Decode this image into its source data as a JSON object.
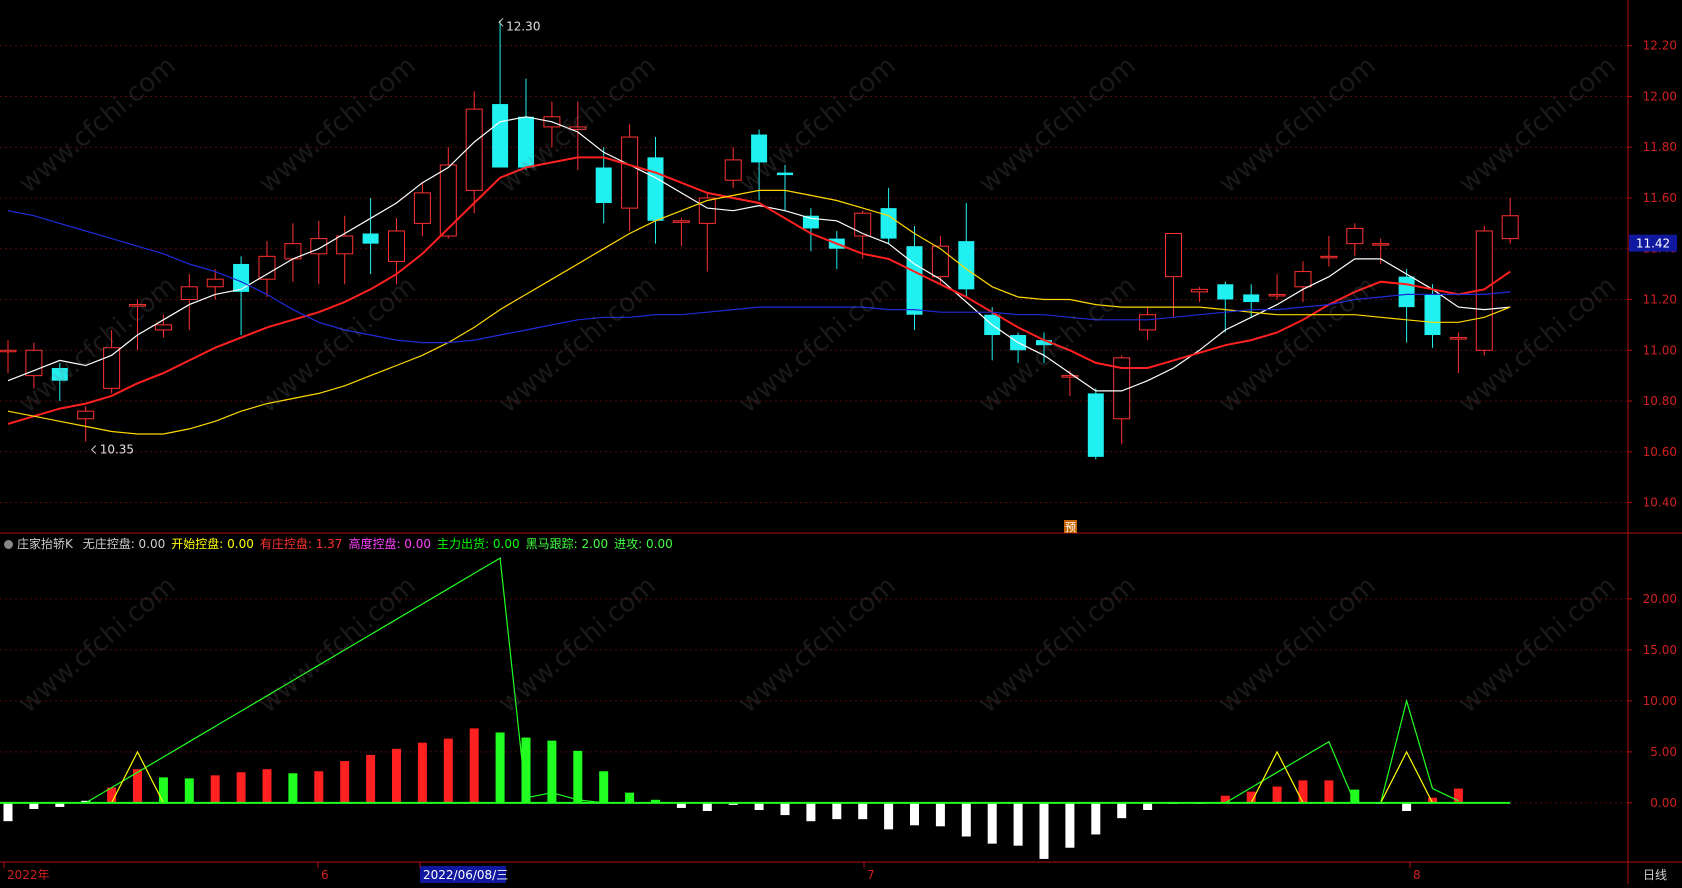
{
  "chart_data": [
    {
      "type": "candlestick",
      "title": "",
      "yaxis": {
        "ticks": [
          "12.20",
          "12.00",
          "11.80",
          "11.60",
          "11.40",
          "11.20",
          "11.00",
          "10.80",
          "10.60",
          "10.40"
        ],
        "range": [
          10.28,
          12.38
        ]
      },
      "last_price_label": "11.42",
      "high_annotation": "12.30",
      "low_annotation": "10.35",
      "pre_marker": "预",
      "candles": [
        {
          "o": 11.0,
          "c": 11.0,
          "h": 11.04,
          "l": 10.91
        },
        {
          "o": 10.9,
          "c": 11.0,
          "h": 11.03,
          "l": 10.85
        },
        {
          "o": 10.93,
          "c": 10.88,
          "h": 10.95,
          "l": 10.8
        },
        {
          "o": 10.73,
          "c": 10.76,
          "h": 10.78,
          "l": 10.64
        },
        {
          "o": 10.85,
          "c": 11.01,
          "h": 11.08,
          "l": 10.83
        },
        {
          "o": 11.18,
          "c": 11.18,
          "h": 11.2,
          "l": 11.0
        },
        {
          "o": 11.08,
          "c": 11.1,
          "h": 11.14,
          "l": 11.05
        },
        {
          "o": 11.2,
          "c": 11.25,
          "h": 11.3,
          "l": 11.08
        },
        {
          "o": 11.25,
          "c": 11.28,
          "h": 11.32,
          "l": 11.2
        },
        {
          "o": 11.34,
          "c": 11.23,
          "h": 11.37,
          "l": 11.06
        },
        {
          "o": 11.28,
          "c": 11.37,
          "h": 11.43,
          "l": 11.21
        },
        {
          "o": 11.36,
          "c": 11.42,
          "h": 11.5,
          "l": 11.27
        },
        {
          "o": 11.38,
          "c": 11.44,
          "h": 11.51,
          "l": 11.26
        },
        {
          "o": 11.38,
          "c": 11.45,
          "h": 11.53,
          "l": 11.26
        },
        {
          "o": 11.46,
          "c": 11.42,
          "h": 11.6,
          "l": 11.3
        },
        {
          "o": 11.35,
          "c": 11.47,
          "h": 11.52,
          "l": 11.26
        },
        {
          "o": 11.5,
          "c": 11.62,
          "h": 11.66,
          "l": 11.45
        },
        {
          "o": 11.45,
          "c": 11.73,
          "h": 11.8,
          "l": 11.44
        },
        {
          "o": 11.63,
          "c": 11.95,
          "h": 12.02,
          "l": 11.54
        },
        {
          "o": 11.97,
          "c": 11.72,
          "h": 12.3,
          "l": 11.72
        },
        {
          "o": 11.92,
          "c": 11.72,
          "h": 12.07,
          "l": 11.71
        },
        {
          "o": 11.88,
          "c": 11.92,
          "h": 11.98,
          "l": 11.8
        },
        {
          "o": 11.87,
          "c": 11.88,
          "h": 11.98,
          "l": 11.71
        },
        {
          "o": 11.72,
          "c": 11.58,
          "h": 11.8,
          "l": 11.5
        },
        {
          "o": 11.56,
          "c": 11.84,
          "h": 11.89,
          "l": 11.47
        },
        {
          "o": 11.76,
          "c": 11.51,
          "h": 11.84,
          "l": 11.42
        },
        {
          "o": 11.51,
          "c": 11.51,
          "h": 11.52,
          "l": 11.41
        },
        {
          "o": 11.5,
          "c": 11.6,
          "h": 11.62,
          "l": 11.31
        },
        {
          "o": 11.67,
          "c": 11.75,
          "h": 11.8,
          "l": 11.64
        },
        {
          "o": 11.85,
          "c": 11.74,
          "h": 11.87,
          "l": 11.59
        },
        {
          "o": 11.7,
          "c": 11.69,
          "h": 11.73,
          "l": 11.55
        },
        {
          "o": 11.53,
          "c": 11.48,
          "h": 11.56,
          "l": 11.39
        },
        {
          "o": 11.44,
          "c": 11.4,
          "h": 11.47,
          "l": 11.32
        },
        {
          "o": 11.45,
          "c": 11.54,
          "h": 11.55,
          "l": 11.36
        },
        {
          "o": 11.56,
          "c": 11.44,
          "h": 11.64,
          "l": 11.42
        },
        {
          "o": 11.41,
          "c": 11.14,
          "h": 11.49,
          "l": 11.08
        },
        {
          "o": 11.29,
          "c": 11.41,
          "h": 11.45,
          "l": 11.26
        },
        {
          "o": 11.43,
          "c": 11.24,
          "h": 11.58,
          "l": 11.21
        },
        {
          "o": 11.14,
          "c": 11.06,
          "h": 11.17,
          "l": 10.96
        },
        {
          "o": 11.06,
          "c": 11.0,
          "h": 11.07,
          "l": 10.95
        },
        {
          "o": 11.04,
          "c": 11.02,
          "h": 11.07,
          "l": 10.95
        },
        {
          "o": 10.9,
          "c": 10.9,
          "h": 10.92,
          "l": 10.82
        },
        {
          "o": 10.83,
          "c": 10.58,
          "h": 10.85,
          "l": 10.57
        },
        {
          "o": 10.73,
          "c": 10.97,
          "h": 10.98,
          "l": 10.63
        },
        {
          "o": 11.08,
          "c": 11.14,
          "h": 11.17,
          "l": 11.04
        },
        {
          "o": 11.29,
          "c": 11.46,
          "h": 11.46,
          "l": 11.13
        },
        {
          "o": 11.23,
          "c": 11.24,
          "h": 11.25,
          "l": 11.19
        },
        {
          "o": 11.26,
          "c": 11.2,
          "h": 11.27,
          "l": 11.07
        },
        {
          "o": 11.22,
          "c": 11.19,
          "h": 11.26,
          "l": 11.13
        },
        {
          "o": 11.22,
          "c": 11.22,
          "h": 11.3,
          "l": 11.2
        },
        {
          "o": 11.25,
          "c": 11.31,
          "h": 11.35,
          "l": 11.19
        },
        {
          "o": 11.37,
          "c": 11.37,
          "h": 11.45,
          "l": 11.33
        },
        {
          "o": 11.42,
          "c": 11.48,
          "h": 11.5,
          "l": 11.37
        },
        {
          "o": 11.42,
          "c": 11.42,
          "h": 11.44,
          "l": 11.34
        },
        {
          "o": 11.29,
          "c": 11.17,
          "h": 11.32,
          "l": 11.03
        },
        {
          "o": 11.22,
          "c": 11.06,
          "h": 11.26,
          "l": 11.01
        },
        {
          "o": 11.05,
          "c": 11.05,
          "h": 11.07,
          "l": 10.91
        },
        {
          "o": 11.0,
          "c": 11.47,
          "h": 11.49,
          "l": 10.98
        },
        {
          "o": 11.44,
          "c": 11.53,
          "h": 11.6,
          "l": 11.42
        }
      ],
      "ma_lines": [
        {
          "color": "#ffffff",
          "values": [
            10.88,
            10.92,
            10.96,
            10.94,
            10.98,
            11.06,
            11.12,
            11.18,
            11.22,
            11.24,
            11.3,
            11.36,
            11.4,
            11.46,
            11.52,
            11.58,
            11.66,
            11.72,
            11.82,
            11.9,
            11.92,
            11.9,
            11.86,
            11.78,
            11.73,
            11.68,
            11.62,
            11.56,
            11.55,
            11.57,
            11.55,
            11.52,
            11.51,
            11.46,
            11.42,
            11.34,
            11.28,
            11.19,
            11.1,
            11.03,
            10.98,
            10.91,
            10.84,
            10.84,
            10.88,
            10.93,
            11.0,
            11.08,
            11.13,
            11.18,
            11.24,
            11.29,
            11.36,
            11.36,
            11.3,
            11.24,
            11.17,
            11.16,
            11.17
          ]
        },
        {
          "color": "#ff2020",
          "values": [
            10.71,
            10.74,
            10.77,
            10.79,
            10.82,
            10.87,
            10.91,
            10.96,
            11.01,
            11.05,
            11.09,
            11.12,
            11.15,
            11.19,
            11.24,
            11.3,
            11.38,
            11.48,
            11.58,
            11.68,
            11.72,
            11.74,
            11.76,
            11.76,
            11.73,
            11.7,
            11.66,
            11.62,
            11.6,
            11.58,
            11.52,
            11.46,
            11.42,
            11.38,
            11.36,
            11.31,
            11.26,
            11.21,
            11.15,
            11.09,
            11.04,
            11.0,
            10.95,
            10.93,
            10.93,
            10.96,
            10.99,
            11.02,
            11.04,
            11.07,
            11.12,
            11.18,
            11.23,
            11.27,
            11.26,
            11.24,
            11.22,
            11.24,
            11.31
          ]
        },
        {
          "color": "#ffd700",
          "values": [
            10.76,
            10.74,
            10.72,
            10.7,
            10.68,
            10.67,
            10.67,
            10.69,
            10.72,
            10.76,
            10.79,
            10.81,
            10.83,
            10.86,
            10.9,
            10.94,
            10.98,
            11.03,
            11.09,
            11.16,
            11.22,
            11.28,
            11.34,
            11.4,
            11.46,
            11.51,
            11.55,
            11.59,
            11.61,
            11.63,
            11.63,
            11.61,
            11.59,
            11.56,
            11.53,
            11.46,
            11.4,
            11.32,
            11.25,
            11.21,
            11.2,
            11.2,
            11.18,
            11.17,
            11.17,
            11.17,
            11.17,
            11.16,
            11.15,
            11.14,
            11.14,
            11.14,
            11.14,
            11.13,
            11.12,
            11.11,
            11.11,
            11.13,
            11.17
          ]
        },
        {
          "color": "#1f2bd8",
          "values": [
            11.55,
            11.53,
            11.5,
            11.47,
            11.44,
            11.41,
            11.38,
            11.34,
            11.31,
            11.27,
            11.22,
            11.16,
            11.11,
            11.08,
            11.06,
            11.04,
            11.03,
            11.03,
            11.04,
            11.06,
            11.08,
            11.1,
            11.12,
            11.13,
            11.13,
            11.14,
            11.14,
            11.15,
            11.16,
            11.17,
            11.17,
            11.17,
            11.17,
            11.17,
            11.16,
            11.16,
            11.15,
            11.15,
            11.15,
            11.14,
            11.14,
            11.13,
            11.12,
            11.12,
            11.12,
            11.13,
            11.14,
            11.15,
            11.16,
            11.16,
            11.17,
            11.18,
            11.2,
            11.21,
            11.22,
            11.22,
            11.22,
            11.22,
            11.23
          ]
        }
      ]
    },
    {
      "type": "bar",
      "title": "庄家抬轿K",
      "indicator_values": [
        {
          "label": "无庄控盘:",
          "value": "0.00",
          "color": "#d0d0d0"
        },
        {
          "label": "开始控盘:",
          "value": "0.00",
          "color": "#ffff00"
        },
        {
          "label": "有庄控盘:",
          "value": "1.37",
          "color": "#ff3030"
        },
        {
          "label": "高度控盘:",
          "value": "0.00",
          "color": "#ff40ff"
        },
        {
          "label": "主力出货:",
          "value": "0.00",
          "color": "#00ff00"
        },
        {
          "label": "黑马跟踪:",
          "value": "2.00",
          "color": "#40ff40"
        },
        {
          "label": "进攻:",
          "value": "0.00",
          "color": "#40ff40"
        }
      ],
      "yaxis": {
        "ticks": [
          "20.00",
          "15.00",
          "10.00",
          "5.00",
          "0.00"
        ],
        "range": [
          -5.8,
          24.5
        ]
      },
      "values": [
        -1.8,
        -0.6,
        -0.4,
        0.2,
        1.5,
        3.3,
        2.5,
        2.4,
        2.7,
        3.0,
        3.3,
        2.9,
        3.1,
        4.1,
        4.7,
        5.3,
        5.9,
        6.3,
        7.3,
        6.9,
        6.4,
        6.1,
        5.1,
        3.1,
        1.0,
        0.3,
        -0.5,
        -0.8,
        -0.2,
        -0.7,
        -1.2,
        -1.8,
        -1.6,
        -1.6,
        -2.6,
        -2.2,
        -2.3,
        -3.3,
        -4.0,
        -4.2,
        -5.5,
        -4.4,
        -3.1,
        -1.5,
        -0.7,
        0,
        0,
        0.7,
        1.1,
        1.6,
        2.2,
        2.2,
        1.3,
        0,
        -0.8,
        0.5,
        1.4
      ],
      "bar_colors": [
        "#ffffff",
        "#ffffff",
        "#ffffff",
        "#ffffff",
        "#ff2020",
        "#ff2020",
        "#20ff20",
        "#20ff20",
        "#ff2020",
        "#ff2020",
        "#ff2020",
        "#20ff20",
        "#ff2020",
        "#ff2020",
        "#ff2020",
        "#ff2020",
        "#ff2020",
        "#ff2020",
        "#ff2020",
        "#20ff20",
        "#20ff20",
        "#20ff20",
        "#20ff20",
        "#20ff20",
        "#20ff20",
        "#20ff20",
        "#ffffff",
        "#ffffff",
        "#ffffff",
        "#ffffff",
        "#ffffff",
        "#ffffff",
        "#ffffff",
        "#ffffff",
        "#ffffff",
        "#ffffff",
        "#ffffff",
        "#ffffff",
        "#ffffff",
        "#ffffff",
        "#ffffff",
        "#ffffff",
        "#ffffff",
        "#ffffff",
        "#ffffff",
        "#ffffff",
        "#ffffff",
        "#ff2020",
        "#ff2020",
        "#ff2020",
        "#ff2020",
        "#ff2020",
        "#20ff20",
        "#ffffff",
        "#ffffff",
        "#ff2020",
        "#ff2020"
      ],
      "series": [
        {
          "color": "#20ff20",
          "values": [
            0,
            0,
            0,
            0,
            1.5,
            3.0,
            4.5,
            6.0,
            7.5,
            9.0,
            10.5,
            12.0,
            13.5,
            15.0,
            16.5,
            18.0,
            19.5,
            21.0,
            22.5,
            24.0,
            0.5,
            1.0,
            0.3,
            0,
            0,
            0,
            0,
            0,
            0,
            0,
            0,
            0,
            0,
            0,
            0,
            0,
            0,
            0,
            0,
            0,
            0,
            0,
            0,
            0,
            0,
            0,
            0,
            0,
            1.5,
            3.0,
            4.5,
            6.0,
            0,
            0,
            10.0,
            1.4,
            0.2
          ]
        },
        {
          "color": "#ffff00",
          "values": [
            0,
            0,
            0,
            0,
            0,
            5.0,
            0,
            0,
            0,
            0,
            0,
            0,
            0,
            0,
            0,
            0,
            0,
            0,
            0,
            0,
            0,
            0,
            0,
            0,
            0,
            0,
            0,
            0,
            0,
            0,
            0,
            0,
            0,
            0,
            0,
            0,
            0,
            0,
            0,
            0,
            0,
            0,
            0,
            0,
            0,
            0,
            0,
            0,
            0,
            5.0,
            0,
            0,
            0,
            0,
            5.0,
            0,
            0
          ]
        }
      ]
    }
  ],
  "xaxis_labels": [
    "2022年",
    "6",
    "2022/06/08/三",
    "7",
    "8"
  ],
  "period_label": "日线",
  "watermark": "www.cfchi.com"
}
